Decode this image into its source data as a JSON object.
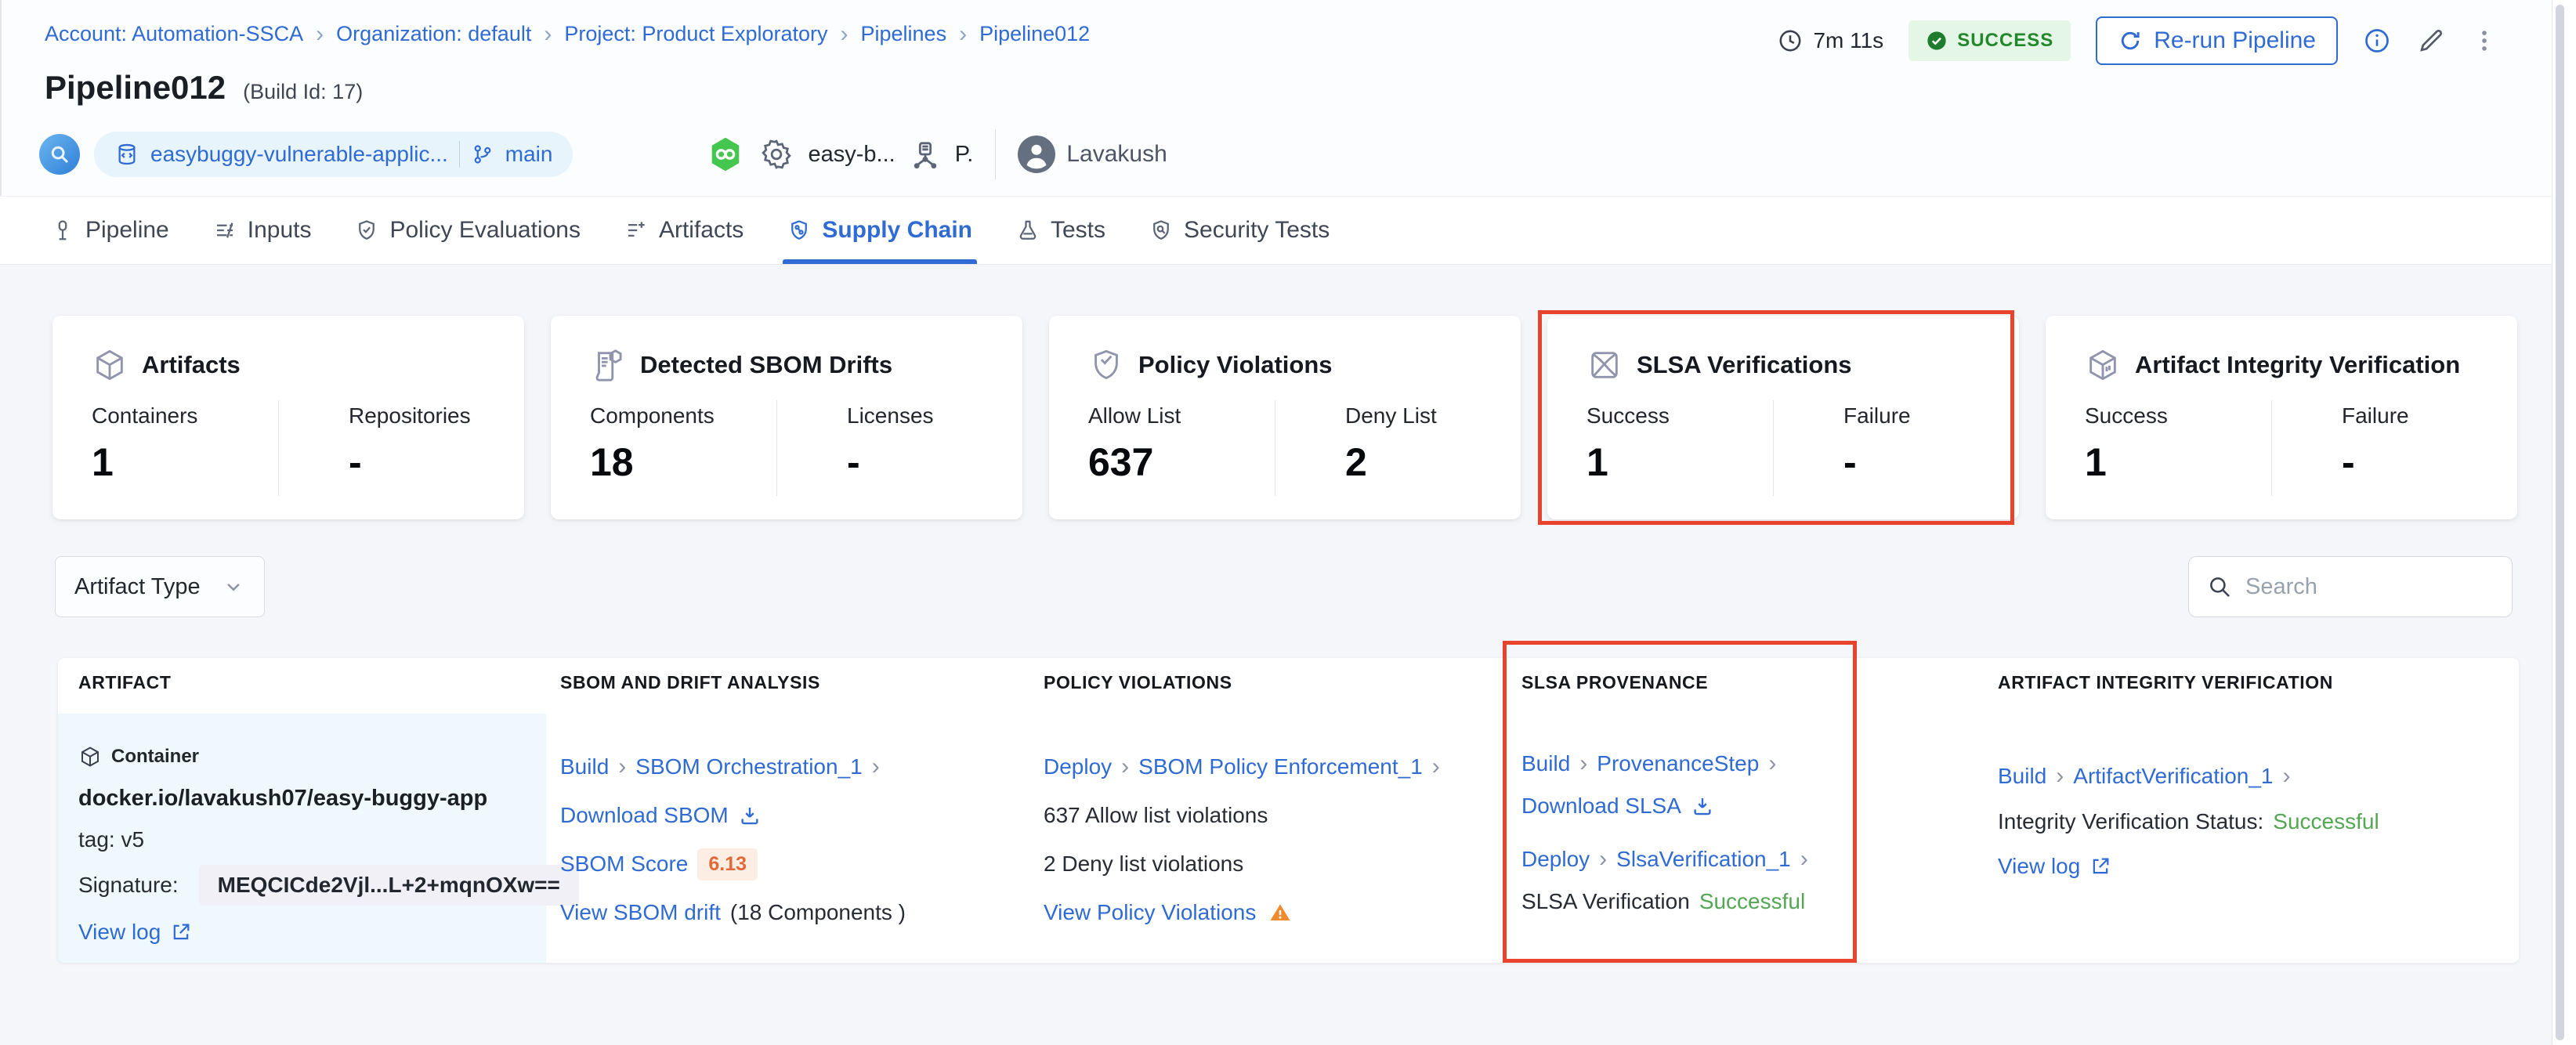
{
  "glyphs": {
    "chevron": "›"
  },
  "colors": {
    "accent_blue": "#2f6bd3",
    "success_green": "#53a653",
    "status_badge_bg": "#e4f6e5",
    "status_badge_text": "#23882b",
    "highlight_red": "#e8432c",
    "score_orange": "#e3683a",
    "warning_orange": "#f08a2e"
  },
  "breadcrumb": {
    "items": [
      "Account: Automation-SSCA",
      "Organization: default",
      "Project: Product Exploratory",
      "Pipelines",
      "Pipeline012"
    ]
  },
  "run": {
    "duration": "7m 11s",
    "status": "SUCCESS",
    "rerun_label": "Re-run Pipeline"
  },
  "header": {
    "title": "Pipeline012",
    "build_id": "(Build Id: 17)",
    "repo": "easybuggy-vulnerable-applic...",
    "branch": "main",
    "trigger_pipeline": "easy-b...",
    "trigger_project": "P.",
    "user": "Lavakush"
  },
  "tabs": [
    {
      "label": "Pipeline",
      "active": false
    },
    {
      "label": "Inputs",
      "active": false
    },
    {
      "label": "Policy Evaluations",
      "active": false
    },
    {
      "label": "Artifacts",
      "active": false
    },
    {
      "label": "Supply Chain",
      "active": true
    },
    {
      "label": "Tests",
      "active": false
    },
    {
      "label": "Security Tests",
      "active": false
    }
  ],
  "summary_cards": [
    {
      "title": "Artifacts",
      "metrics": [
        {
          "label": "Containers",
          "value": "1"
        },
        {
          "label": "Repositories",
          "value": "-"
        }
      ]
    },
    {
      "title": "Detected SBOM Drifts",
      "metrics": [
        {
          "label": "Components",
          "value": "18"
        },
        {
          "label": "Licenses",
          "value": "-"
        }
      ]
    },
    {
      "title": "Policy Violations",
      "metrics": [
        {
          "label": "Allow List",
          "value": "637"
        },
        {
          "label": "Deny List",
          "value": "2"
        }
      ]
    },
    {
      "title": "SLSA Verifications",
      "highlighted": true,
      "metrics": [
        {
          "label": "Success",
          "value": "1"
        },
        {
          "label": "Failure",
          "value": "-"
        }
      ]
    },
    {
      "title": "Artifact Integrity Verification",
      "metrics": [
        {
          "label": "Success",
          "value": "1"
        },
        {
          "label": "Failure",
          "value": "-"
        }
      ]
    }
  ],
  "filters": {
    "artifact_type_label": "Artifact Type",
    "search_placeholder": "Search"
  },
  "table": {
    "headers": [
      "ARTIFACT",
      "SBOM AND DRIFT ANALYSIS",
      "POLICY VIOLATIONS",
      "SLSA PROVENANCE",
      "ARTIFACT INTEGRITY VERIFICATION"
    ],
    "row": {
      "artifact": {
        "type": "Container",
        "name": "docker.io/lavakush07/easy-buggy-app",
        "tag": "tag: v5",
        "signature_label": "Signature:",
        "signature_value": "MEQCICde2Vjl...L+2+mqnOXw==",
        "view_log_label": "View log"
      },
      "sbom": {
        "stage": "Build",
        "step": "SBOM Orchestration_1",
        "download_label": "Download SBOM",
        "score_label": "SBOM Score",
        "score_value": "6.13",
        "drift_label": "View SBOM drift",
        "drift_count": "(18 Components )"
      },
      "policy": {
        "stage": "Deploy",
        "step": "SBOM Policy Enforcement_1",
        "allow_text": "637 Allow list violations",
        "deny_text": "2 Deny list violations",
        "view_label": "View Policy Violations"
      },
      "slsa": {
        "stage1": "Build",
        "step1": "ProvenanceStep",
        "download_label": "Download SLSA",
        "stage2": "Deploy",
        "step2": "SlsaVerification_1",
        "status_label": "SLSA Verification",
        "status_value": "Successful"
      },
      "integrity": {
        "stage": "Build",
        "step": "ArtifactVerification_1",
        "status_label": "Integrity Verification Status:",
        "status_value": "Successful",
        "view_log_label": "View log"
      }
    }
  }
}
